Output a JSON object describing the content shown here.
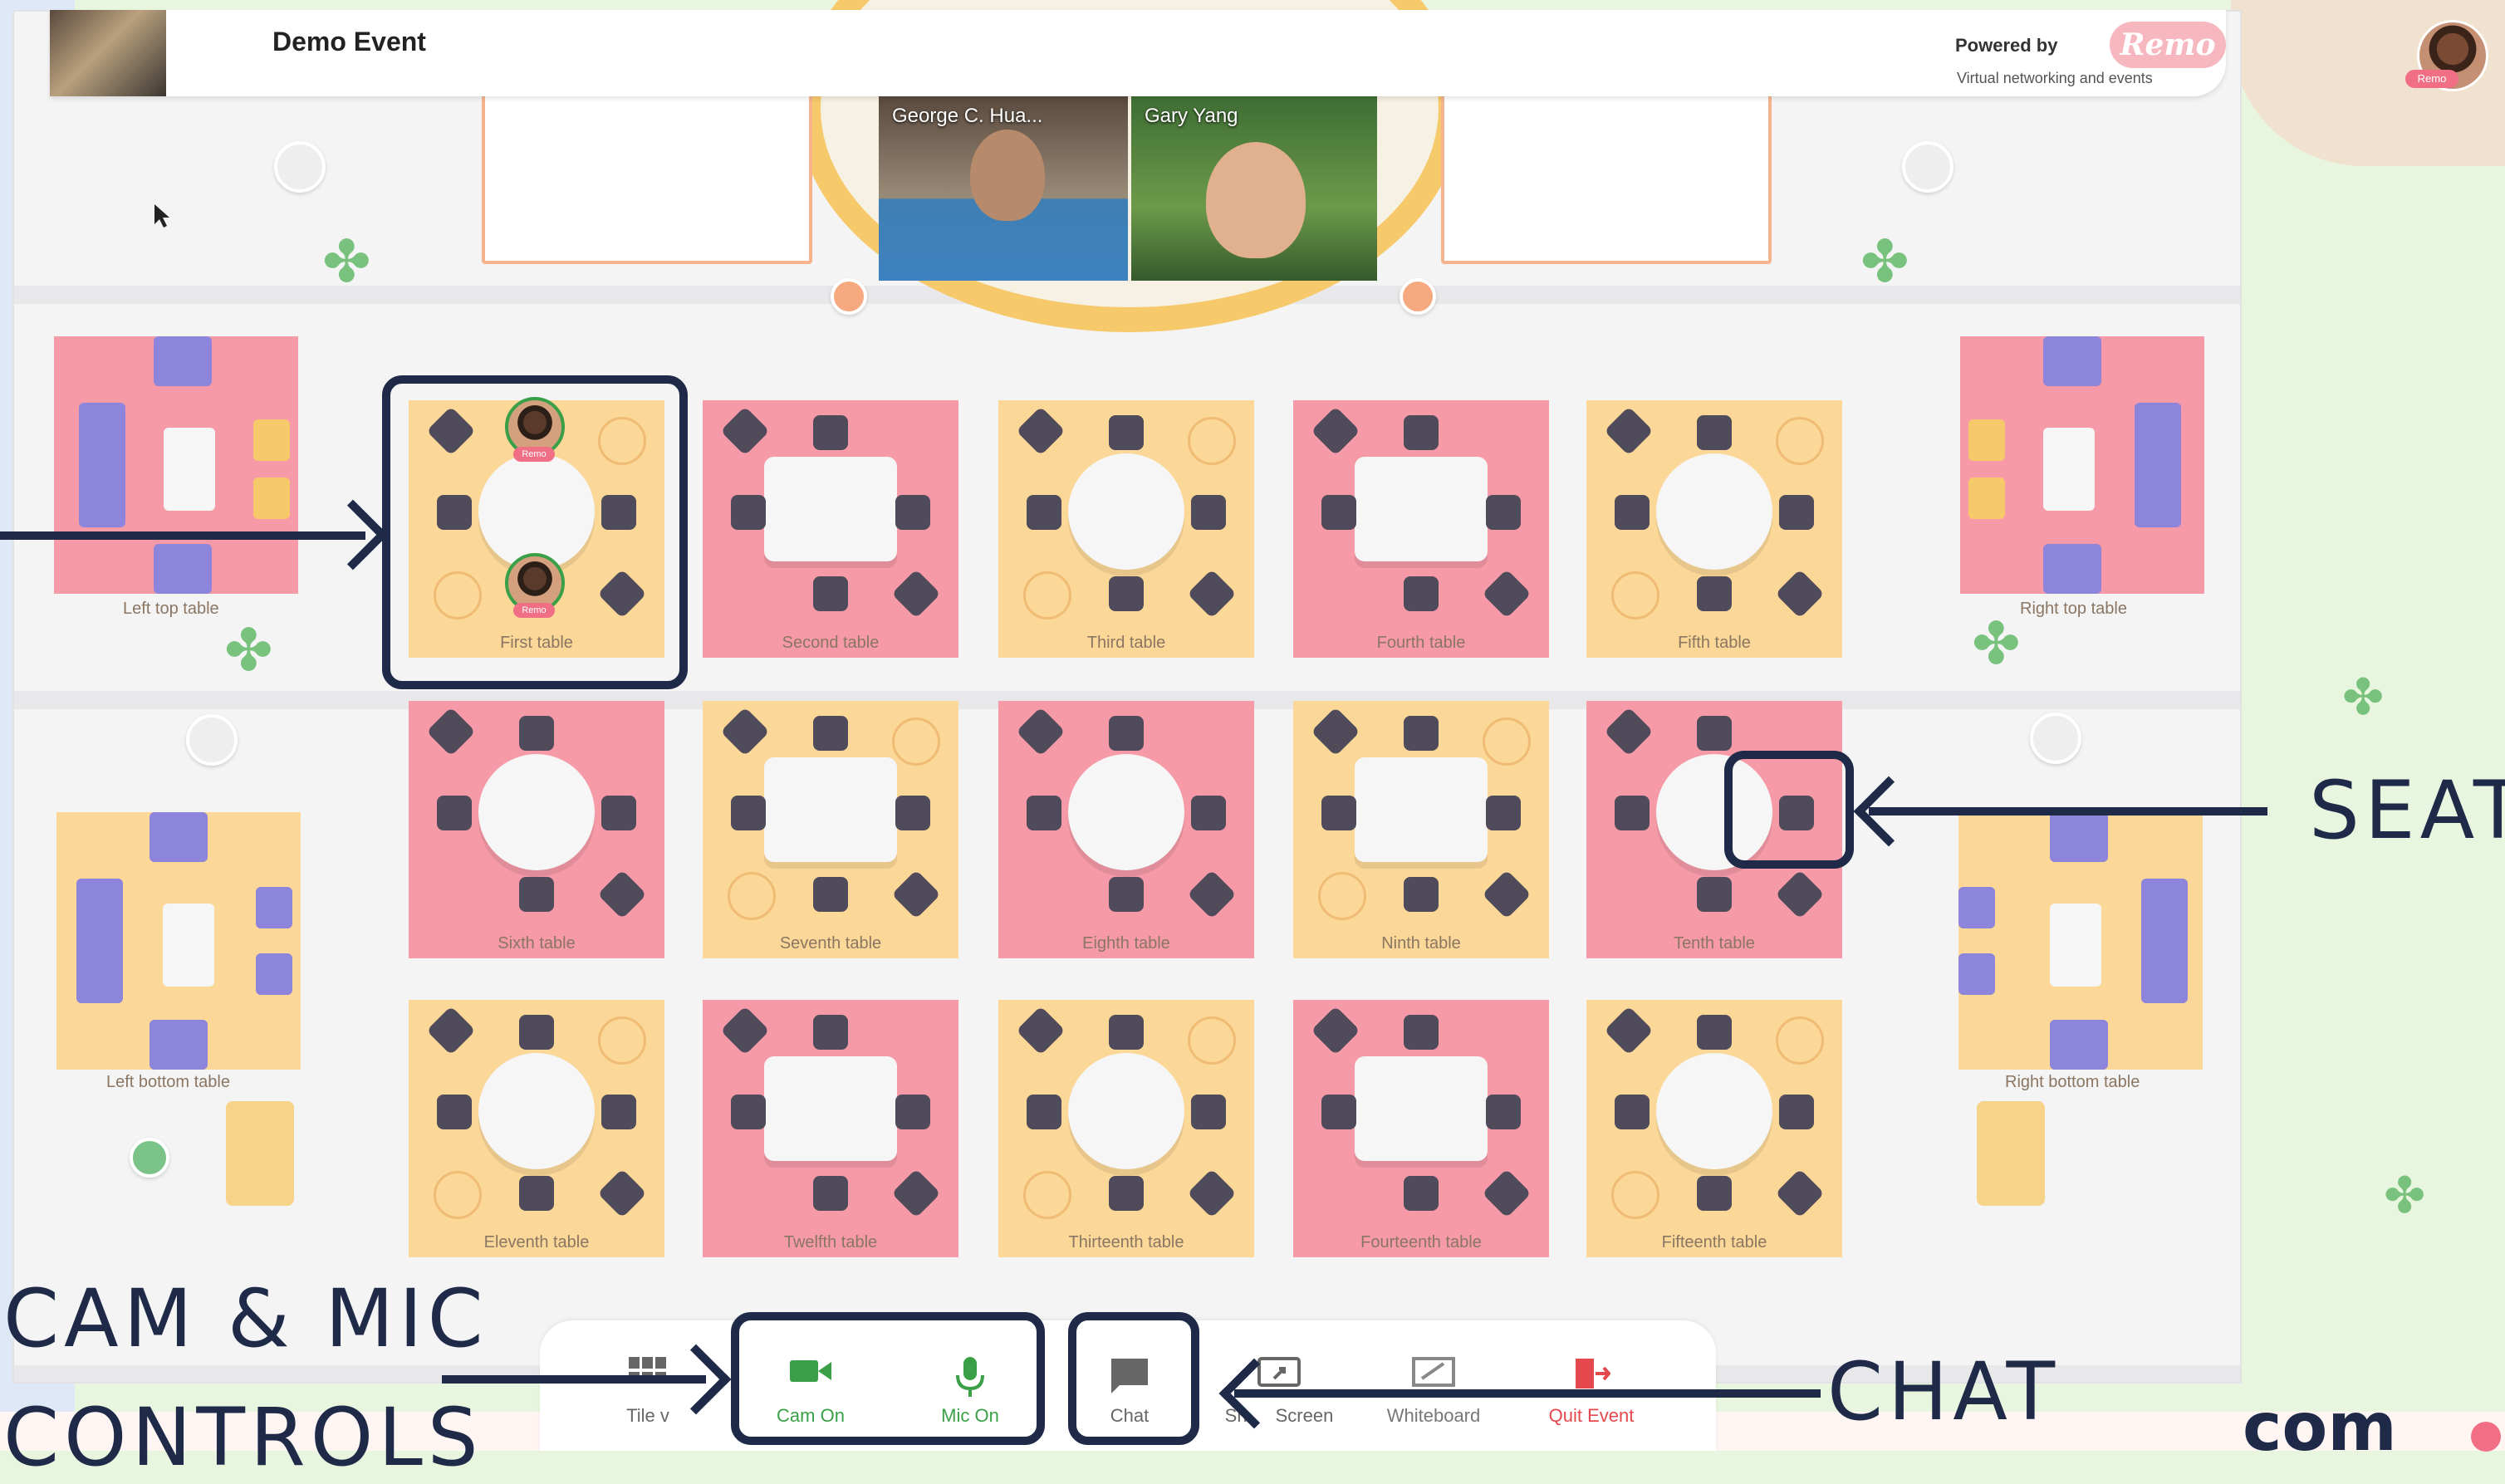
{
  "header": {
    "event_title": "Demo Event",
    "powered_by": "Powered by",
    "brand": "Remo",
    "tagline": "Virtual networking and events",
    "profile_badge": "Remo"
  },
  "stage": {
    "speakers": [
      {
        "name": "George C. Hua..."
      },
      {
        "name": "Gary Yang"
      }
    ]
  },
  "floor": {
    "lounges": [
      {
        "label": "Left top table"
      },
      {
        "label": "Right top table"
      },
      {
        "label": "Left bottom table"
      },
      {
        "label": "Right bottom table"
      }
    ],
    "tables": [
      {
        "label": "First table",
        "shape": "round",
        "color": "yellow"
      },
      {
        "label": "Second table",
        "shape": "rect",
        "color": "pink"
      },
      {
        "label": "Third table",
        "shape": "round",
        "color": "yellow"
      },
      {
        "label": "Fourth table",
        "shape": "rect",
        "color": "pink"
      },
      {
        "label": "Fifth table",
        "shape": "round",
        "color": "yellow"
      },
      {
        "label": "Sixth table",
        "shape": "round",
        "color": "pink"
      },
      {
        "label": "Seventh table",
        "shape": "rect",
        "color": "yellow"
      },
      {
        "label": "Eighth table",
        "shape": "round",
        "color": "pink"
      },
      {
        "label": "Ninth table",
        "shape": "rect",
        "color": "yellow"
      },
      {
        "label": "Tenth table",
        "shape": "round",
        "color": "pink"
      },
      {
        "label": "Eleventh table",
        "shape": "round",
        "color": "yellow"
      },
      {
        "label": "Twelfth table",
        "shape": "rect",
        "color": "pink"
      },
      {
        "label": "Thirteenth table",
        "shape": "round",
        "color": "yellow"
      },
      {
        "label": "Fourteenth table",
        "shape": "rect",
        "color": "pink"
      },
      {
        "label": "Fifteenth table",
        "shape": "round",
        "color": "yellow"
      }
    ],
    "first_table_badges": [
      "Remo",
      "Remo"
    ]
  },
  "toolbar": {
    "tile_view": "Tile v",
    "cam": "Cam On",
    "mic": "Mic On",
    "chat": "Chat",
    "share": "Screen",
    "share_prefix": "Sh",
    "whiteboard": "Whiteboard",
    "quit": "Quit Event"
  },
  "annotations": {
    "seat": "SEAT",
    "cam_mic_line1": "CAM & MIC",
    "cam_mic_line2": "CONTROLS",
    "chat": "CHAT",
    "corner_logo": "com"
  },
  "colors": {
    "pink_table": "#f59aa6",
    "yellow_table": "#fbd798",
    "accent_green": "#3aa047",
    "quit_red": "#e5484d",
    "annotation": "#1e2a48"
  }
}
